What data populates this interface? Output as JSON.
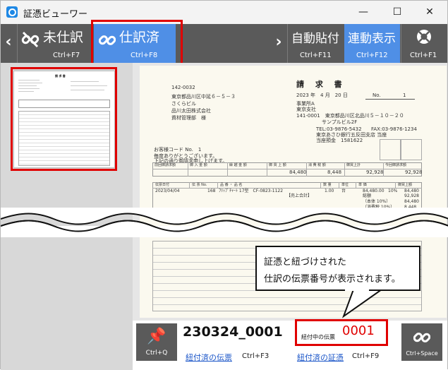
{
  "window": {
    "title": "証憑ビューワー",
    "minimize": "—",
    "maximize": "☐",
    "close": "✕"
  },
  "toolbar": {
    "left_arrow": "‹",
    "unposted": {
      "label": "未仕訳",
      "shortcut": "Ctrl+F7"
    },
    "posted": {
      "label": "仕訳済",
      "shortcut": "Ctrl+F8"
    },
    "right_arrow": "›",
    "auto_attach": {
      "label": "自動貼付",
      "shortcut": "Ctrl+F11"
    },
    "linked_display": {
      "label": "連動表示",
      "shortcut": "Ctrl+F12"
    },
    "help": {
      "shortcut": "Ctrl+F1"
    }
  },
  "invoice": {
    "title": "請 求 書",
    "zip": "142-0032",
    "address": "東京都品川区中延６－５－３",
    "building": "さくらビル",
    "company": "品川太田株式会社",
    "dept": "資材管理部　様",
    "date": "2023 年　4 月　20 日",
    "no_label": "No.",
    "no_value": "1",
    "issuer_office": "事業所A",
    "issuer_branch": "東京支社",
    "issuer_address": "141-0001　東京都品川区北品川５－１０－２０",
    "issuer_building": "サンプルビル2F",
    "tel": "TEL:03-9876-5432",
    "fax": "FAX:03-9876-1234",
    "bank": "東京あさひ銀行五反田支店 当座",
    "account": "当座預金　1581622",
    "customer_code": "お客様コード No.　1",
    "greeting1": "毎度ありがとうございます。",
    "greeting2": "下記の通り御請求申し上げます。",
    "cols": [
      "前回御請求額",
      "御 入 金 額",
      "繰 越 金 額",
      "御 買 上 額",
      "消 費 税 額",
      "御買上計",
      "今回御請求額"
    ],
    "vals": [
      "",
      "",
      "",
      "84,480",
      "8,448",
      "92,928",
      "92,928"
    ],
    "detail_cols": [
      "伝票日付",
      "伝 票 No.",
      "品 番 ・ 品 名",
      "数 量",
      "単位",
      "単 価",
      "御買上額"
    ],
    "row_date": "2023/04/04",
    "row_no": "168",
    "row_item": "ﾌﾘｯﾌﾟﾁｬｰﾄ 17型　CF-0823-1122",
    "row_qty": "1.00",
    "row_unit": "台",
    "row_price": "84,480.00",
    "row_tax": "10%",
    "row_amount": "84,480",
    "subtotal_label": "【売上合計】",
    "sub_total_label": "総額",
    "sub_total": "92,928",
    "sub_base_label": "（本体 10%）",
    "sub_base": "84,480",
    "sub_tax_label": "（消費税 10%）",
    "sub_tax": "8,448"
  },
  "bottom": {
    "pin_shortcut": "Ctrl+Q",
    "voucher_no": "230324_0001",
    "link_voucher": "紐付済の伝票",
    "link_voucher_sc": "Ctrl+F3",
    "link_evidence": "紐付済の証憑",
    "link_evidence_sc": "Ctrl+F9",
    "tag_label": "紐付中の伝票",
    "tag_number": "0001",
    "link_shortcut": "Ctrl+Space"
  },
  "callout": {
    "line1": "証憑と紐づけされた",
    "line2": "仕訳の伝票番号が表示されます。"
  }
}
